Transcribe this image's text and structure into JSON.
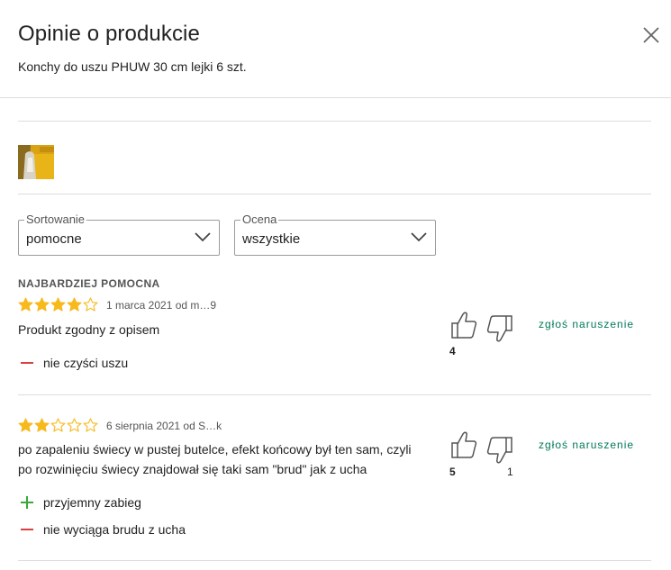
{
  "header": {
    "title": "Opinie o produkcie",
    "product_name": "Konchy do uszu PHUW 30 cm lejki 6 szt."
  },
  "filters": {
    "sort": {
      "legend": "Sortowanie",
      "value": "pomocne"
    },
    "rating": {
      "legend": "Ocena",
      "value": "wszystkie"
    }
  },
  "reviews": [
    {
      "badge": "NAJBARDZIEJ POMOCNA",
      "rating": 4,
      "max_rating": 5,
      "meta": "1 marca 2021 od m…9",
      "text_lines": [
        "Produkt zgodny z opisem"
      ],
      "pros": [],
      "cons": [
        "nie czyści uszu"
      ],
      "helpful": "4",
      "unhelpful": "",
      "report": "zgłoś naruszenie"
    },
    {
      "badge": "",
      "rating": 2,
      "max_rating": 5,
      "meta": "6 sierpnia 2021 od S…k",
      "text_lines": [
        "po zapaleniu świecy w pustej butelce, efekt końcowy był ten sam, czyli",
        "po rozwinięciu świecy znajdował się taki sam \"brud\" jak z ucha"
      ],
      "pros": [
        "przyjemny zabieg"
      ],
      "cons": [
        "nie wyciąga brudu z ucha"
      ],
      "helpful": "5",
      "unhelpful": "1",
      "report": "zgłoś naruszenie"
    }
  ],
  "colors": {
    "star": "#f7b91c",
    "star_empty": "#f7b91c",
    "pro": "#3aa935",
    "con": "#d94040",
    "report_link": "#00795a",
    "divider": "#dddddd"
  },
  "icons": {
    "close": "close-icon",
    "chevron": "chevron-down-icon",
    "thumb_up": "thumbs-up-icon",
    "thumb_down": "thumbs-down-icon",
    "star": "star-icon",
    "plus": "plus-icon",
    "minus": "minus-icon"
  }
}
